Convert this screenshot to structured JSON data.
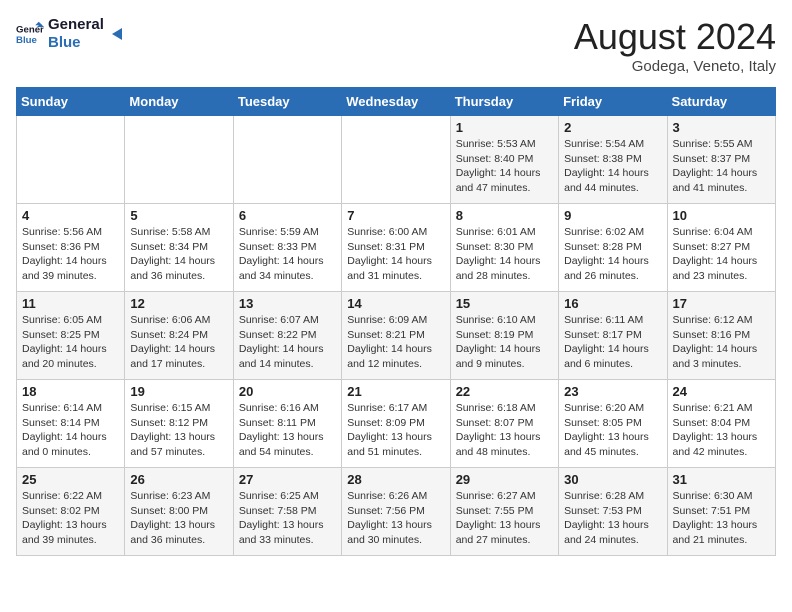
{
  "logo": {
    "line1": "General",
    "line2": "Blue"
  },
  "title": "August 2024",
  "location": "Godega, Veneto, Italy",
  "days_of_week": [
    "Sunday",
    "Monday",
    "Tuesday",
    "Wednesday",
    "Thursday",
    "Friday",
    "Saturday"
  ],
  "weeks": [
    [
      {
        "day": "",
        "content": ""
      },
      {
        "day": "",
        "content": ""
      },
      {
        "day": "",
        "content": ""
      },
      {
        "day": "",
        "content": ""
      },
      {
        "day": "1",
        "content": "Sunrise: 5:53 AM\nSunset: 8:40 PM\nDaylight: 14 hours and 47 minutes."
      },
      {
        "day": "2",
        "content": "Sunrise: 5:54 AM\nSunset: 8:38 PM\nDaylight: 14 hours and 44 minutes."
      },
      {
        "day": "3",
        "content": "Sunrise: 5:55 AM\nSunset: 8:37 PM\nDaylight: 14 hours and 41 minutes."
      }
    ],
    [
      {
        "day": "4",
        "content": "Sunrise: 5:56 AM\nSunset: 8:36 PM\nDaylight: 14 hours and 39 minutes."
      },
      {
        "day": "5",
        "content": "Sunrise: 5:58 AM\nSunset: 8:34 PM\nDaylight: 14 hours and 36 minutes."
      },
      {
        "day": "6",
        "content": "Sunrise: 5:59 AM\nSunset: 8:33 PM\nDaylight: 14 hours and 34 minutes."
      },
      {
        "day": "7",
        "content": "Sunrise: 6:00 AM\nSunset: 8:31 PM\nDaylight: 14 hours and 31 minutes."
      },
      {
        "day": "8",
        "content": "Sunrise: 6:01 AM\nSunset: 8:30 PM\nDaylight: 14 hours and 28 minutes."
      },
      {
        "day": "9",
        "content": "Sunrise: 6:02 AM\nSunset: 8:28 PM\nDaylight: 14 hours and 26 minutes."
      },
      {
        "day": "10",
        "content": "Sunrise: 6:04 AM\nSunset: 8:27 PM\nDaylight: 14 hours and 23 minutes."
      }
    ],
    [
      {
        "day": "11",
        "content": "Sunrise: 6:05 AM\nSunset: 8:25 PM\nDaylight: 14 hours and 20 minutes."
      },
      {
        "day": "12",
        "content": "Sunrise: 6:06 AM\nSunset: 8:24 PM\nDaylight: 14 hours and 17 minutes."
      },
      {
        "day": "13",
        "content": "Sunrise: 6:07 AM\nSunset: 8:22 PM\nDaylight: 14 hours and 14 minutes."
      },
      {
        "day": "14",
        "content": "Sunrise: 6:09 AM\nSunset: 8:21 PM\nDaylight: 14 hours and 12 minutes."
      },
      {
        "day": "15",
        "content": "Sunrise: 6:10 AM\nSunset: 8:19 PM\nDaylight: 14 hours and 9 minutes."
      },
      {
        "day": "16",
        "content": "Sunrise: 6:11 AM\nSunset: 8:17 PM\nDaylight: 14 hours and 6 minutes."
      },
      {
        "day": "17",
        "content": "Sunrise: 6:12 AM\nSunset: 8:16 PM\nDaylight: 14 hours and 3 minutes."
      }
    ],
    [
      {
        "day": "18",
        "content": "Sunrise: 6:14 AM\nSunset: 8:14 PM\nDaylight: 14 hours and 0 minutes."
      },
      {
        "day": "19",
        "content": "Sunrise: 6:15 AM\nSunset: 8:12 PM\nDaylight: 13 hours and 57 minutes."
      },
      {
        "day": "20",
        "content": "Sunrise: 6:16 AM\nSunset: 8:11 PM\nDaylight: 13 hours and 54 minutes."
      },
      {
        "day": "21",
        "content": "Sunrise: 6:17 AM\nSunset: 8:09 PM\nDaylight: 13 hours and 51 minutes."
      },
      {
        "day": "22",
        "content": "Sunrise: 6:18 AM\nSunset: 8:07 PM\nDaylight: 13 hours and 48 minutes."
      },
      {
        "day": "23",
        "content": "Sunrise: 6:20 AM\nSunset: 8:05 PM\nDaylight: 13 hours and 45 minutes."
      },
      {
        "day": "24",
        "content": "Sunrise: 6:21 AM\nSunset: 8:04 PM\nDaylight: 13 hours and 42 minutes."
      }
    ],
    [
      {
        "day": "25",
        "content": "Sunrise: 6:22 AM\nSunset: 8:02 PM\nDaylight: 13 hours and 39 minutes."
      },
      {
        "day": "26",
        "content": "Sunrise: 6:23 AM\nSunset: 8:00 PM\nDaylight: 13 hours and 36 minutes."
      },
      {
        "day": "27",
        "content": "Sunrise: 6:25 AM\nSunset: 7:58 PM\nDaylight: 13 hours and 33 minutes."
      },
      {
        "day": "28",
        "content": "Sunrise: 6:26 AM\nSunset: 7:56 PM\nDaylight: 13 hours and 30 minutes."
      },
      {
        "day": "29",
        "content": "Sunrise: 6:27 AM\nSunset: 7:55 PM\nDaylight: 13 hours and 27 minutes."
      },
      {
        "day": "30",
        "content": "Sunrise: 6:28 AM\nSunset: 7:53 PM\nDaylight: 13 hours and 24 minutes."
      },
      {
        "day": "31",
        "content": "Sunrise: 6:30 AM\nSunset: 7:51 PM\nDaylight: 13 hours and 21 minutes."
      }
    ]
  ]
}
